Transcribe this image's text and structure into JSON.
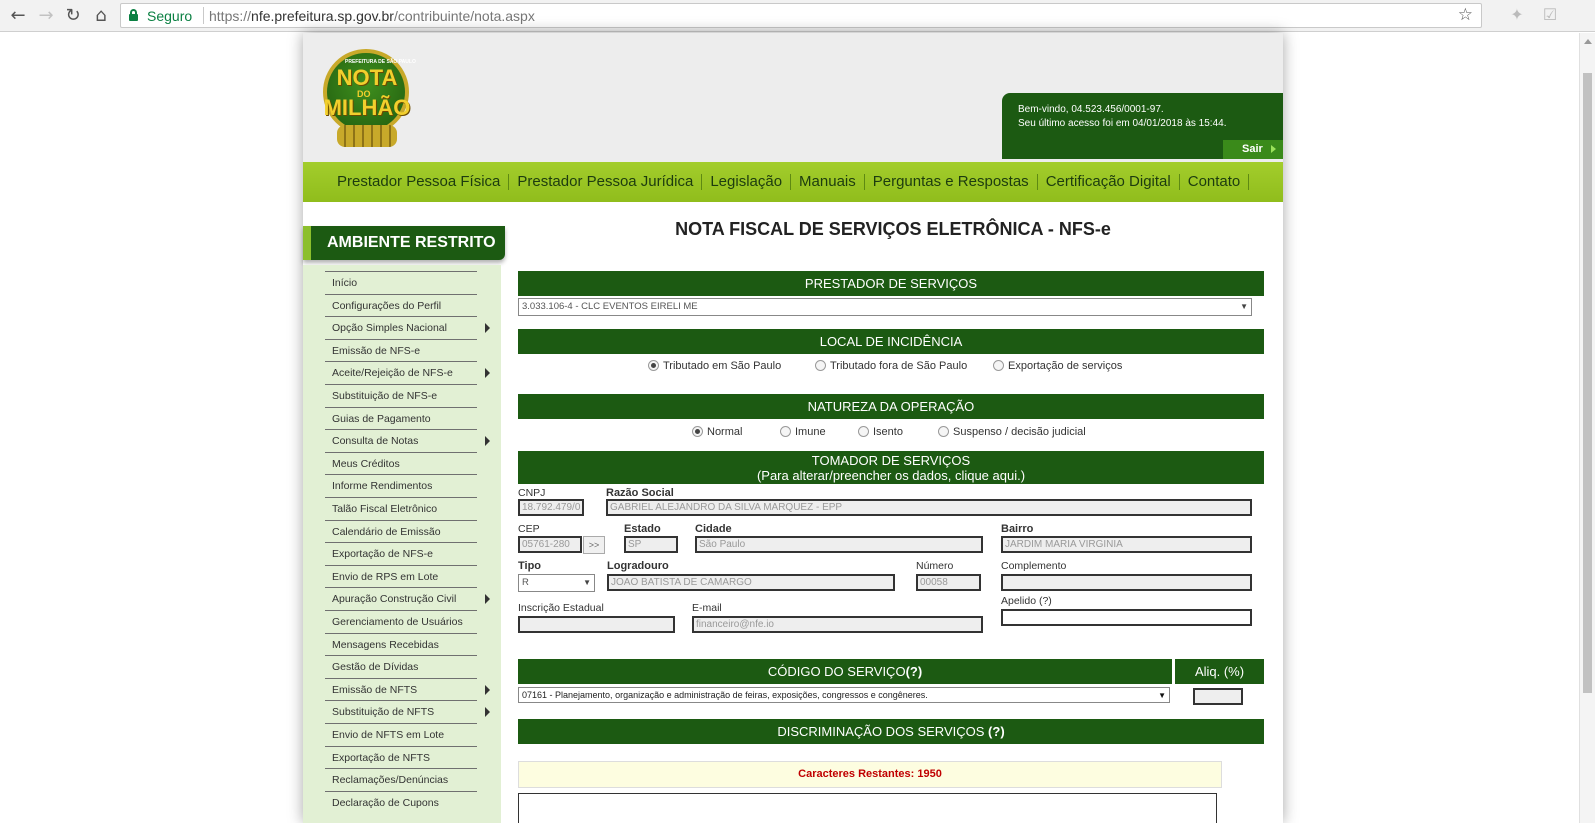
{
  "browser": {
    "secure_label": "Seguro",
    "url_scheme": "https://",
    "url_host": "nfe.prefeitura.sp.gov.br",
    "url_path": "/contribuinte/nota.aspx"
  },
  "header": {
    "logo": {
      "small_text": "PREFEITURA DE SÃO PAULO",
      "line1": "NOTA",
      "line2": "DO",
      "line3": "MILHÃO"
    },
    "welcome_line1": "Bem-vindo, 04.523.456/0001-97.",
    "welcome_line2": "Seu último acesso foi em 04/01/2018 às 15:44.",
    "logout_label": "Sair"
  },
  "topnav": [
    "Prestador Pessoa Física",
    "Prestador Pessoa Jurídica",
    "Legislação",
    "Manuais",
    "Perguntas e Respostas",
    "Certificação Digital",
    "Contato"
  ],
  "sidebar": {
    "heading": "AMBIENTE RESTRITO",
    "items": [
      {
        "label": "Início",
        "submenu": false
      },
      {
        "label": "Configurações do Perfil",
        "submenu": false
      },
      {
        "label": "Opção Simples Nacional",
        "submenu": true
      },
      {
        "label": "Emissão de NFS-e",
        "submenu": false
      },
      {
        "label": "Aceite/Rejeição de NFS-e",
        "submenu": true
      },
      {
        "label": "Substituição de NFS-e",
        "submenu": false
      },
      {
        "label": "Guias de Pagamento",
        "submenu": false
      },
      {
        "label": "Consulta de Notas",
        "submenu": true
      },
      {
        "label": "Meus Créditos",
        "submenu": false
      },
      {
        "label": "Informe Rendimentos",
        "submenu": false
      },
      {
        "label": "Talão Fiscal Eletrônico",
        "submenu": false
      },
      {
        "label": "Calendário de Emissão",
        "submenu": false
      },
      {
        "label": "Exportação de NFS-e",
        "submenu": false
      },
      {
        "label": "Envio de RPS em Lote",
        "submenu": false
      },
      {
        "label": "Apuração Construção Civil",
        "submenu": true
      },
      {
        "label": "Gerenciamento de Usuários",
        "submenu": false
      },
      {
        "label": "Mensagens Recebidas",
        "submenu": false
      },
      {
        "label": "Gestão de Dívidas",
        "submenu": false
      },
      {
        "label": "Emissão de NFTS",
        "submenu": true
      },
      {
        "label": "Substituição de NFTS",
        "submenu": true
      },
      {
        "label": "Envio de NFTS em Lote",
        "submenu": false
      },
      {
        "label": "Exportação de NFTS",
        "submenu": false
      },
      {
        "label": "Reclamações/Denúncias",
        "submenu": false
      },
      {
        "label": "Declaração de Cupons",
        "submenu": false
      }
    ]
  },
  "form": {
    "title": "NOTA FISCAL DE SERVIÇOS ELETRÔNICA - NFS-e",
    "prestador": {
      "heading": "PRESTADOR DE SERVIÇOS",
      "selected": "3.033.106-4 - CLC EVENTOS EIRELI ME"
    },
    "local": {
      "heading": "LOCAL DE INCIDÊNCIA",
      "options": [
        "Tributado em São Paulo",
        "Tributado fora de São Paulo",
        "Exportação de serviços"
      ],
      "selected_index": 0
    },
    "natureza": {
      "heading": "NATUREZA DA OPERAÇÃO",
      "options": [
        "Normal",
        "Imune",
        "Isento",
        "Suspenso / decisão judicial"
      ],
      "selected_index": 0
    },
    "tomador": {
      "heading": "TOMADOR DE SERVIÇOS",
      "subheading": "(Para alterar/preencher os dados, clique aqui.)",
      "cnpj_label": "CNPJ",
      "cnpj": "18.792.479/0",
      "razao_label": "Razão Social",
      "razao": "GABRIEL ALEJANDRO DA SILVA MARQUEZ - EPP",
      "cep_label": "CEP",
      "cep": "05761-280",
      "cep_button": ">>",
      "estado_label": "Estado",
      "estado": "SP",
      "cidade_label": "Cidade",
      "cidade": "São Paulo",
      "bairro_label": "Bairro",
      "bairro": "JARDIM MARIA VIRGINIA",
      "tipo_label": "Tipo",
      "tipo": "R",
      "logradouro_label": "Logradouro",
      "logradouro": "JOAO BATISTA DE CAMARGO",
      "numero_label": "Número",
      "numero": "00058",
      "complemento_label": "Complemento",
      "complemento": "",
      "apelido_label": "Apelido (?)",
      "apelido": "",
      "ie_label": "Inscrição Estadual",
      "ie": "",
      "email_label": "E-mail",
      "email": "financeiro@nfe.io"
    },
    "servico": {
      "heading": "CÓDIGO DO SERVIÇO",
      "help": "(?)",
      "aliq_heading": "Aliq. (%)",
      "selected": "07161 - Planejamento, organização e administração de feiras, exposições, congressos e congêneres.",
      "aliq": ""
    },
    "discriminacao": {
      "heading": "DISCRIMINAÇÃO DOS SERVIÇOS",
      "help": "(?)",
      "chars_label": "Caracteres Restantes: 1950"
    }
  },
  "colors": {
    "dark_green": "#1c5a12",
    "lime": "#9bc724",
    "menu_bg": "#e2f0d4",
    "alert_red": "#c00000"
  }
}
